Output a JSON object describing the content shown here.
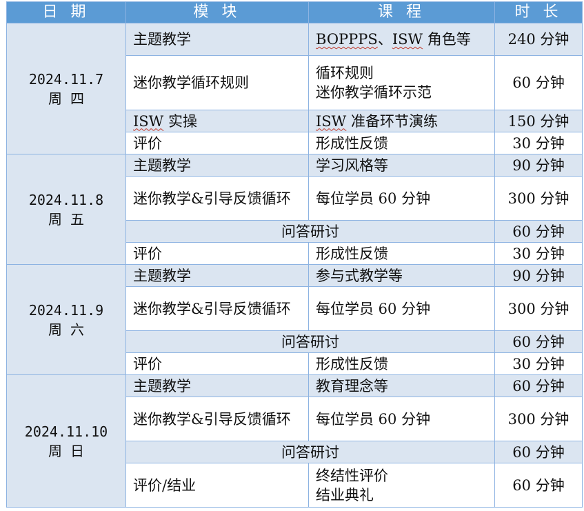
{
  "headers": {
    "date": "日  期",
    "module": "模  块",
    "course": "课  程",
    "duration": "时  长"
  },
  "days": [
    {
      "date": "2024.11.7",
      "weekday": "周  四",
      "rows": [
        {
          "module": "主题教学",
          "course_a": "BOPPPS",
          "course_sep": "、",
          "course_b": "ISW",
          "course_c": " 角色等",
          "duration": "240 分钟"
        },
        {
          "module": "迷你教学循环规则",
          "course_1": "循环规则",
          "course_2": "迷你教学循环示范",
          "duration": "60 分钟"
        },
        {
          "module_a": "ISW",
          "module_b": " 实操",
          "course_a": "ISW",
          "course_b": " 准备环节演练",
          "duration": "150 分钟"
        },
        {
          "module": "评价",
          "course": "形成性反馈",
          "duration": "30 分钟"
        }
      ]
    },
    {
      "date": "2024.11.8",
      "weekday": "周  五",
      "rows": [
        {
          "module": "主题教学",
          "course": "学习风格等",
          "duration": "90 分钟"
        },
        {
          "module": "迷你教学&引导反馈循环",
          "course": "每位学员 60 分钟",
          "duration": "300 分钟"
        },
        {
          "merged": "问答研讨",
          "duration": "60 分钟"
        },
        {
          "module": "评价",
          "course": "形成性反馈",
          "duration": "30 分钟"
        }
      ]
    },
    {
      "date": "2024.11.9",
      "weekday": "周  六",
      "rows": [
        {
          "module": "主题教学",
          "course": "参与式教学等",
          "duration": "90 分钟"
        },
        {
          "module": "迷你教学&引导反馈循环",
          "course": "每位学员 60 分钟",
          "duration": "300 分钟"
        },
        {
          "merged": "问答研讨",
          "duration": "60 分钟"
        },
        {
          "module": "评价",
          "course": "形成性反馈",
          "duration": "30 分钟"
        }
      ]
    },
    {
      "date": "2024.11.10",
      "weekday": "周  日",
      "rows": [
        {
          "module": "主题教学",
          "course": "教育理念等",
          "duration": "60 分钟"
        },
        {
          "module": "迷你教学&引导反馈循环",
          "course": "每位学员 60 分钟",
          "duration": "300 分钟"
        },
        {
          "merged": "问答研讨",
          "duration": "60 分钟"
        },
        {
          "module": "评价/结业",
          "course_1": "终结性评价",
          "course_2": "结业典礼",
          "duration": "60 分钟"
        }
      ]
    }
  ]
}
